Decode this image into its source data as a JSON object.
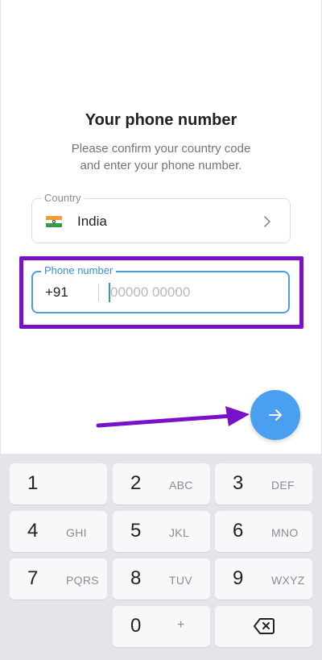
{
  "header": {
    "title": "Your phone number",
    "subtitle_line1": "Please confirm your country code",
    "subtitle_line2": "and enter your phone number."
  },
  "country": {
    "label": "Country",
    "flag_icon": "india-flag-icon",
    "name": "India"
  },
  "phone": {
    "label": "Phone number",
    "dial_code": "+91",
    "value": "",
    "placeholder": "00000 00000"
  },
  "colors": {
    "accent": "#4a9ff0",
    "highlight_annotation": "#7a10c8"
  },
  "keypad": {
    "keys": [
      {
        "digit": "1",
        "letters": ""
      },
      {
        "digit": "2",
        "letters": "ABC"
      },
      {
        "digit": "3",
        "letters": "DEF"
      },
      {
        "digit": "4",
        "letters": "GHI"
      },
      {
        "digit": "5",
        "letters": "JKL"
      },
      {
        "digit": "6",
        "letters": "MNO"
      },
      {
        "digit": "7",
        "letters": "PQRS"
      },
      {
        "digit": "8",
        "letters": "TUV"
      },
      {
        "digit": "9",
        "letters": "WXYZ"
      },
      {
        "digit": "0",
        "letters": "+"
      }
    ]
  }
}
